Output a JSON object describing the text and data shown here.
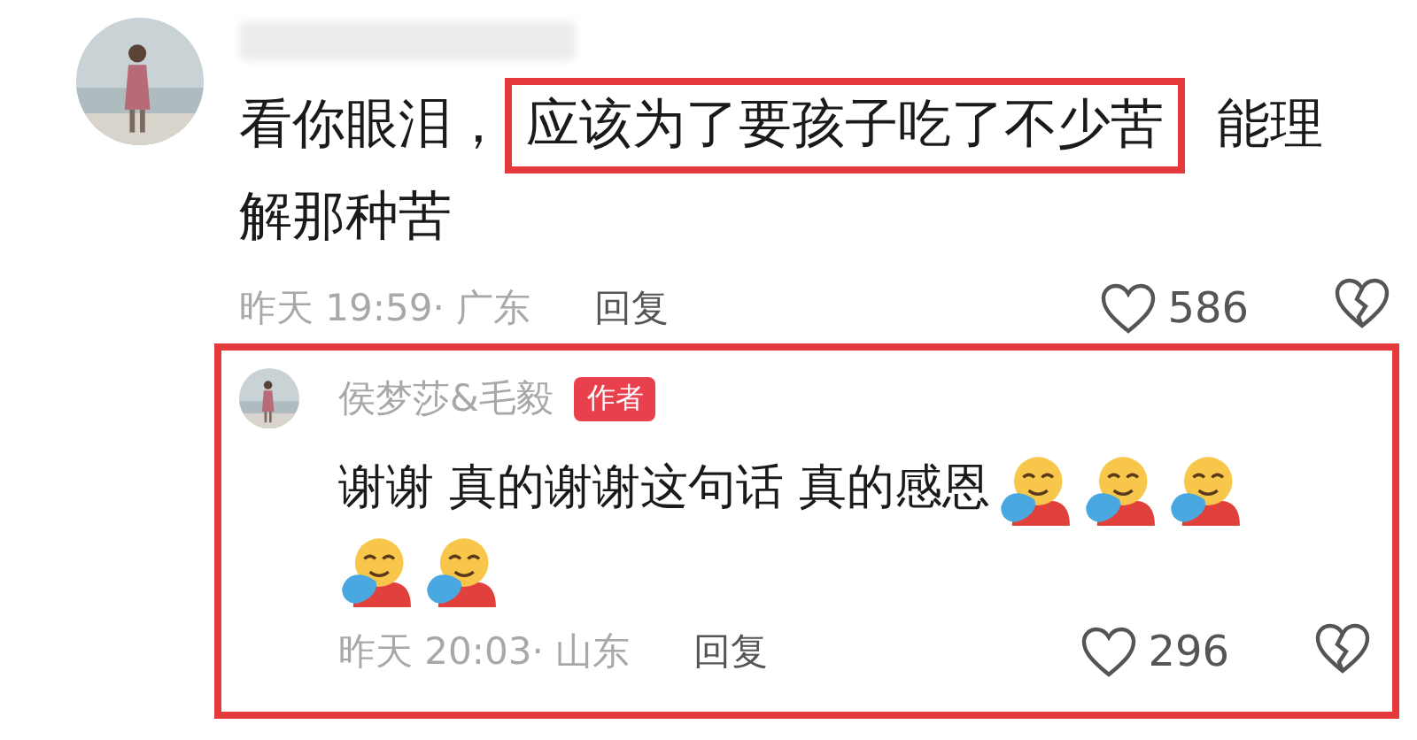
{
  "comment": {
    "name_redacted": true,
    "text": [
      {
        "text": "看你眼泪，",
        "highlighted": false
      },
      {
        "text": "应该为了要孩子吃了不少苦",
        "highlighted": true
      },
      {
        "text": "能理",
        "highlighted": false
      },
      {
        "text": "解那种苦",
        "highlighted": false
      }
    ],
    "time_location": "昨天 19:59· 广东",
    "reply_label": "回复",
    "like_count": "586"
  },
  "reply": {
    "highlighted": true,
    "author": "侯梦莎&毛毅",
    "badge": "作者",
    "text": "谢谢 真的谢谢这句话 真的感恩",
    "emojis": [
      {
        "kind": "hug"
      },
      {
        "kind": "hug"
      },
      {
        "kind": "hug"
      },
      {
        "kind": "hug"
      },
      {
        "kind": "hug"
      }
    ],
    "time_location": "昨天 20:03· 山东",
    "reply_label": "回复",
    "like_count": "296"
  }
}
